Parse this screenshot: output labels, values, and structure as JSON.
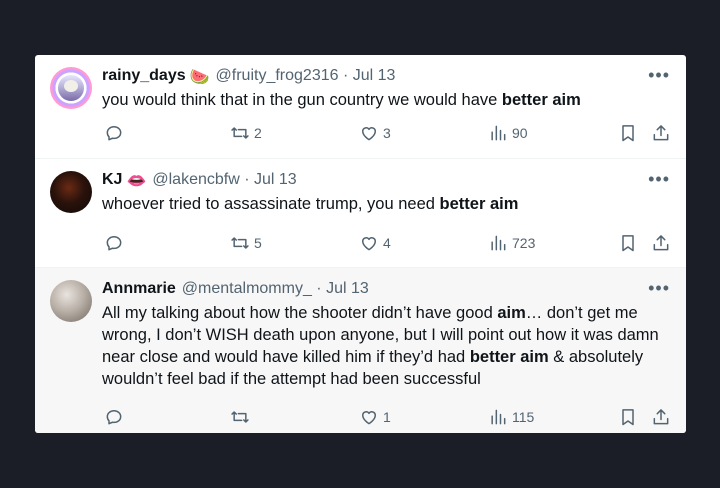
{
  "tweets": [
    {
      "name": "rainy_days",
      "emoji": "🍉",
      "handle": "@fruity_frog2316",
      "date": "Jul 13",
      "text_before": "you would think that in the gun country we would have ",
      "text_bold": "better aim",
      "text_after": "",
      "retweets": "2",
      "likes": "3",
      "views": "90"
    },
    {
      "name": "KJ",
      "emoji": "👄",
      "handle": "@lakencbfw",
      "date": "Jul 13",
      "text_before": "whoever tried to assassinate trump, you need ",
      "text_bold": "better aim",
      "text_after": "",
      "retweets": "5",
      "likes": "4",
      "views": "723"
    },
    {
      "name": "Annmarie",
      "emoji": "",
      "handle": "@mentalmommy_",
      "date": "Jul 13",
      "seg1": "All my talking about how the shooter didn’t have good ",
      "seg2": "aim",
      "seg3": "… don’t get me wrong, I don’t WISH death upon anyone, but I will point out how it was damn near close and would have killed him if they’d had ",
      "seg4": "better aim",
      "seg5": " & absolutely wouldn’t feel bad if the attempt had been successful",
      "retweets": "",
      "likes": "1",
      "views": "115"
    }
  ],
  "more_label": "•••",
  "dot": "·",
  "icons": {
    "reply": "reply-icon",
    "retweet": "retweet-icon",
    "like": "heart-icon",
    "views": "views-icon",
    "bookmark": "bookmark-icon",
    "share": "share-icon"
  },
  "colors": {
    "background": "#1b1e26",
    "card": "#ffffff",
    "secondary_text": "#536471",
    "primary_text": "#0f1419"
  }
}
